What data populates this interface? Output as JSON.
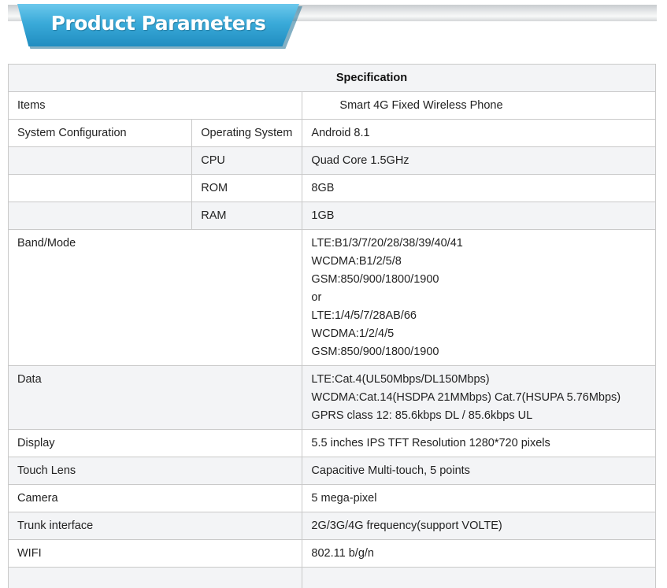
{
  "banner": {
    "title": "Product Parameters"
  },
  "table": {
    "header": "Specification",
    "items_label": "Items",
    "items_value": "Smart 4G Fixed Wireless Phone",
    "system_configuration": {
      "label": "System Configuration",
      "rows": [
        {
          "key": "Operating System",
          "value": "Android 8.1"
        },
        {
          "key": "CPU",
          "value": "Quad Core 1.5GHz"
        },
        {
          "key": "ROM",
          "value": "8GB"
        },
        {
          "key": "RAM",
          "value": "1GB"
        }
      ]
    },
    "band_mode": {
      "label": "Band/Mode",
      "lines": [
        "LTE:B1/3/7/20/28/38/39/40/41",
        "WCDMA:B1/2/5/8",
        "GSM:850/900/1800/1900",
        "or",
        "LTE:1/4/5/7/28AB/66",
        "WCDMA:1/2/4/5",
        "GSM:850/900/1800/1900"
      ]
    },
    "data": {
      "label": "Data",
      "lines": [
        "LTE:Cat.4(UL50Mbps/DL150Mbps)",
        "WCDMA:Cat.14(HSDPA 21MMbps) Cat.7(HSUPA 5.76Mbps)",
        "GPRS class 12: 85.6kbps DL / 85.6kbps UL"
      ]
    },
    "simple_rows": [
      {
        "label": "Display",
        "value": "5.5 inches IPS TFT Resolution 1280*720 pixels"
      },
      {
        "label": "Touch Lens",
        "value": "Capacitive Multi-touch, 5 points"
      },
      {
        "label": "Camera",
        "value": "5 mega-pixel"
      },
      {
        "label": "Trunk interface",
        "value": "2G/3G/4G frequency(support VOLTE)"
      },
      {
        "label": "WIFI",
        "value": "802.11 b/g/n"
      }
    ]
  },
  "colors": {
    "banner_blue": "#2a9bd0",
    "header_gray": "#f3f4f6",
    "border": "#c9c9c9",
    "text": "#222222"
  }
}
